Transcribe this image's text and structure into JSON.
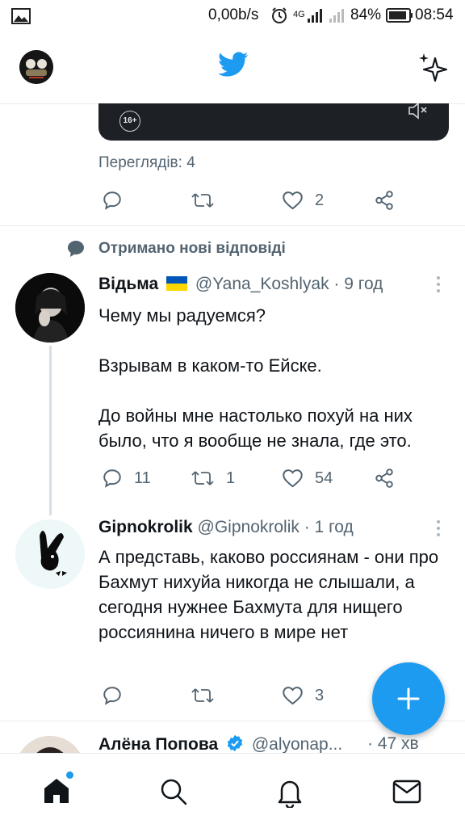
{
  "status_bar": {
    "image_icon": "image-icon",
    "speed": "0,00b/s",
    "network": "4G",
    "battery": "84%",
    "time": "08:54"
  },
  "top_bar": {
    "logo": "twitter-bird-icon",
    "right_icon": "sparkle-icon"
  },
  "prev_tweet": {
    "age_badge": "16+",
    "views": "Переглядів: 4",
    "likes": "2"
  },
  "new_replies_banner": "Отримано нові відповіді",
  "tweets": [
    {
      "name": "Відьма",
      "flag": "🇺🇦",
      "meta": "@Yana_Koshlyak · 9 год",
      "lines": [
        "Чему мы радуемся?",
        "",
        "Взрывам в каком-то Ейске.",
        "",
        "До войны мне настолько похуй на них было, что я вообще не знала, где это."
      ],
      "p1": "Чему мы радуемся?",
      "p2": "Взрывам в каком-то Ейске.",
      "p3": "До войны мне настолько похуй на них было, что я вообще не знала, где это.",
      "replies": "11",
      "retweets": "1",
      "likes": "54"
    },
    {
      "name": "Gipnokrolik",
      "meta": "@Gipnokrolik · 1 год",
      "text": "А представь, каково россиянам - они про Бахмут нихуйа никогда не слышали, а сегодня нужнее Бахмута для нищего россиянина ничего в мире нет",
      "likes": "3"
    },
    {
      "name": "Алёна Попова",
      "meta": "@alyonap...",
      "time": "· 47 хв"
    }
  ],
  "colors": {
    "accent": "#1d9bf0",
    "flag_blue": "#0057b7",
    "flag_yellow": "#ffd700"
  }
}
